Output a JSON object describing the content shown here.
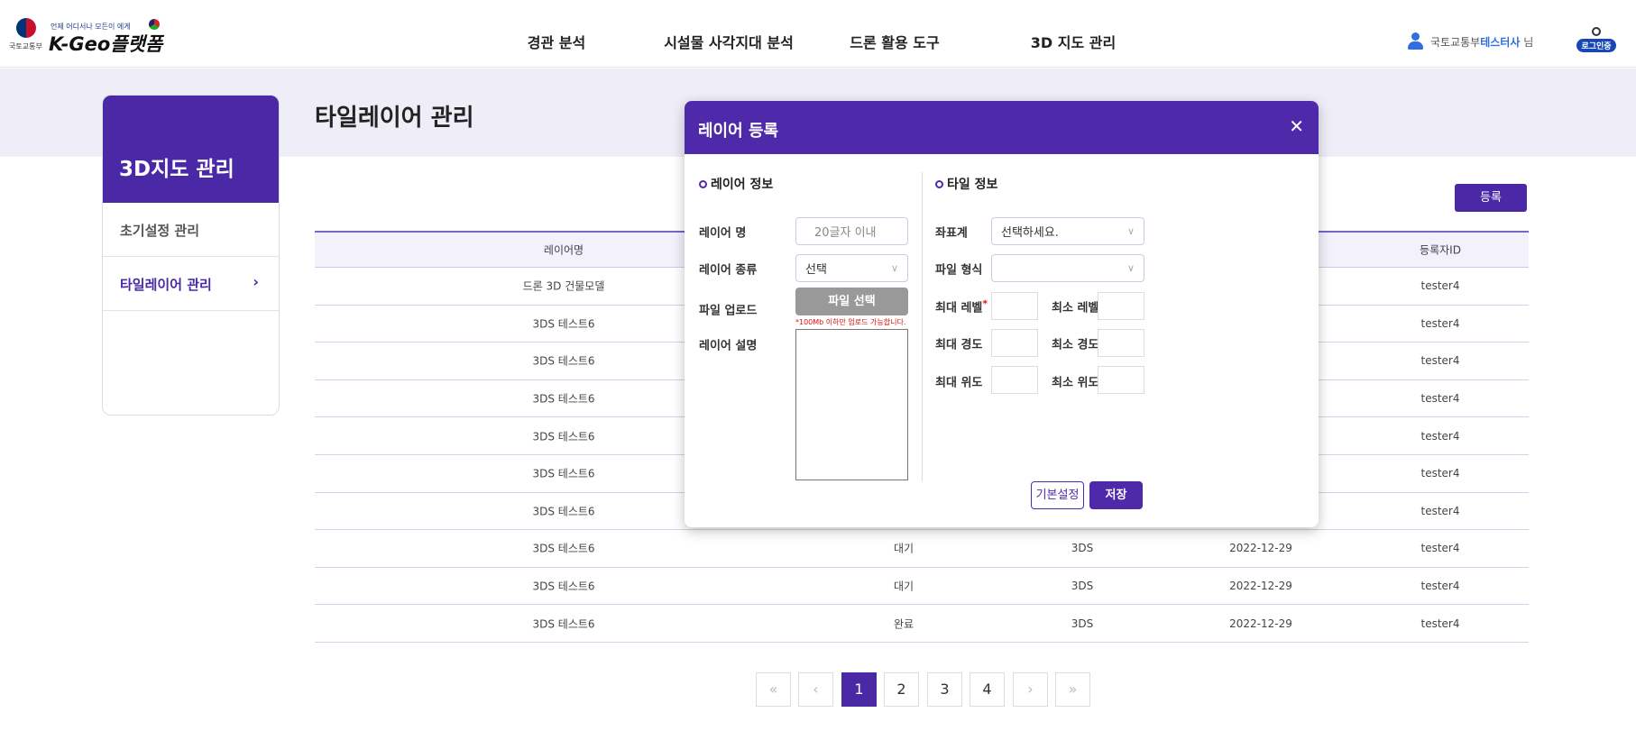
{
  "header": {
    "logo_ministry": "국토교통부",
    "logo_slogan": "언제 어디서나 모든이 에게",
    "logo_title": "K-Geo플랫폼",
    "nav": [
      "경관 분석",
      "시설물 사각지대 분석",
      "드론 활용 도구",
      "3D 지도 관리"
    ],
    "user_org": "국토교통부",
    "user_name": "테스터사",
    "user_suffix": " 님",
    "login_badge": "로그인중"
  },
  "sidebar": {
    "title": "3D지도 관리",
    "items": [
      {
        "label": "초기설정 관리"
      },
      {
        "label": "타일레이어 관리"
      }
    ]
  },
  "page": {
    "title": "타일레이어 관리",
    "register_button": "등록"
  },
  "table": {
    "headers": {
      "name": "레이어명",
      "id": "등록자ID"
    },
    "rows": [
      {
        "name": "드론 3D 건물모델",
        "status": "",
        "type": "",
        "date": "",
        "id": "tester4"
      },
      {
        "name": "3DS 테스트6",
        "status": "",
        "type": "",
        "date": "",
        "id": "tester4"
      },
      {
        "name": "3DS 테스트6",
        "status": "",
        "type": "",
        "date": "",
        "id": "tester4"
      },
      {
        "name": "3DS 테스트6",
        "status": "",
        "type": "",
        "date": "",
        "id": "tester4"
      },
      {
        "name": "3DS 테스트6",
        "status": "",
        "type": "",
        "date": "",
        "id": "tester4"
      },
      {
        "name": "3DS 테스트6",
        "status": "",
        "type": "",
        "date": "",
        "id": "tester4"
      },
      {
        "name": "3DS 테스트6",
        "status": "",
        "type": "",
        "date": "",
        "id": "tester4"
      },
      {
        "name": "3DS 테스트6",
        "status": "대기",
        "type": "3DS",
        "date": "2022-12-29",
        "id": "tester4"
      },
      {
        "name": "3DS 테스트6",
        "status": "대기",
        "type": "3DS",
        "date": "2022-12-29",
        "id": "tester4"
      },
      {
        "name": "3DS 테스트6",
        "status": "완료",
        "type": "3DS",
        "date": "2022-12-29",
        "id": "tester4"
      }
    ]
  },
  "pagination": {
    "first": "«",
    "prev": "‹",
    "pages": [
      "1",
      "2",
      "3",
      "4"
    ],
    "current": "1",
    "next": "›",
    "last": "»"
  },
  "modal": {
    "title": "레이어 등록",
    "close": "✕",
    "layer_section": "레이어 정보",
    "tile_section": "타일 정보",
    "layer_name_label": "레이어 명",
    "layer_name_placeholder": "20글자 이내",
    "layer_type_label": "레이어 종류",
    "layer_type_value": "선택",
    "file_upload_label": "파일 업로드",
    "file_button": "파일 선택",
    "file_note": "*100Mb 이하만 업로드 가능합니다.",
    "desc_label": "레이어 설명",
    "crs_label": "좌표계",
    "crs_value": "선택하세요.",
    "format_label": "파일 형식",
    "format_value": "",
    "max_level": "최대 레벨",
    "min_level": "최소 레벨",
    "max_lon": "최대 경도",
    "min_lon": "최소 경도",
    "max_lat": "최대 위도",
    "min_lat": "최소 위도",
    "required_mark": "*",
    "default_button": "기본설정",
    "save_button": "저장"
  },
  "colors": {
    "primary": "#4e2aab",
    "banner": "#efedf7",
    "required": "#e01010"
  }
}
